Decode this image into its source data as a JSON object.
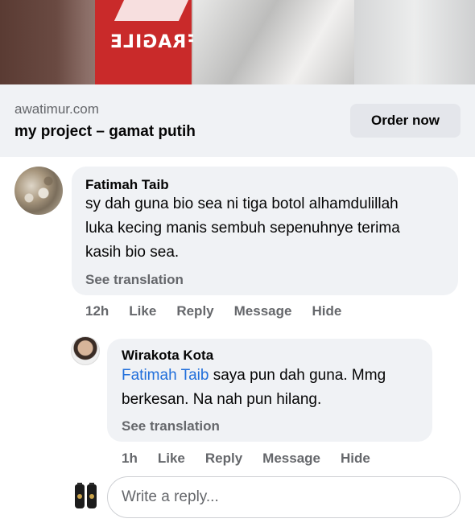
{
  "hero": {
    "image_text": "FRAGILE"
  },
  "link_preview": {
    "domain": "awatimur.com",
    "title": "my project – gamat putih",
    "cta_label": "Order now"
  },
  "comments": [
    {
      "author": "Fatimah Taib",
      "text_lines": [
        "sy dah guna bio sea ni tiga botol alhamdulillah",
        "luka kecing manis sembuh sepenuhnye terima",
        "kasih bio sea."
      ],
      "see_translation": "See translation",
      "time": "12h",
      "actions": [
        "Like",
        "Reply",
        "Message",
        "Hide"
      ]
    },
    {
      "author": "Wirakota Kota",
      "mention": "Fatimah Taib",
      "text_line1_rest": " saya pun dah guna. Mmg",
      "text_line2": "berkesan. Na nah pun hilang.",
      "see_translation": "See translation",
      "time": "1h",
      "actions": [
        "Like",
        "Reply",
        "Message",
        "Hide"
      ]
    }
  ],
  "reply_box": {
    "placeholder": "Write a reply..."
  },
  "colors": {
    "bubble": "#f0f2f5",
    "secondary_text": "#65676b",
    "mention_blue": "#216fdb",
    "button_bg": "#e4e6eb"
  }
}
